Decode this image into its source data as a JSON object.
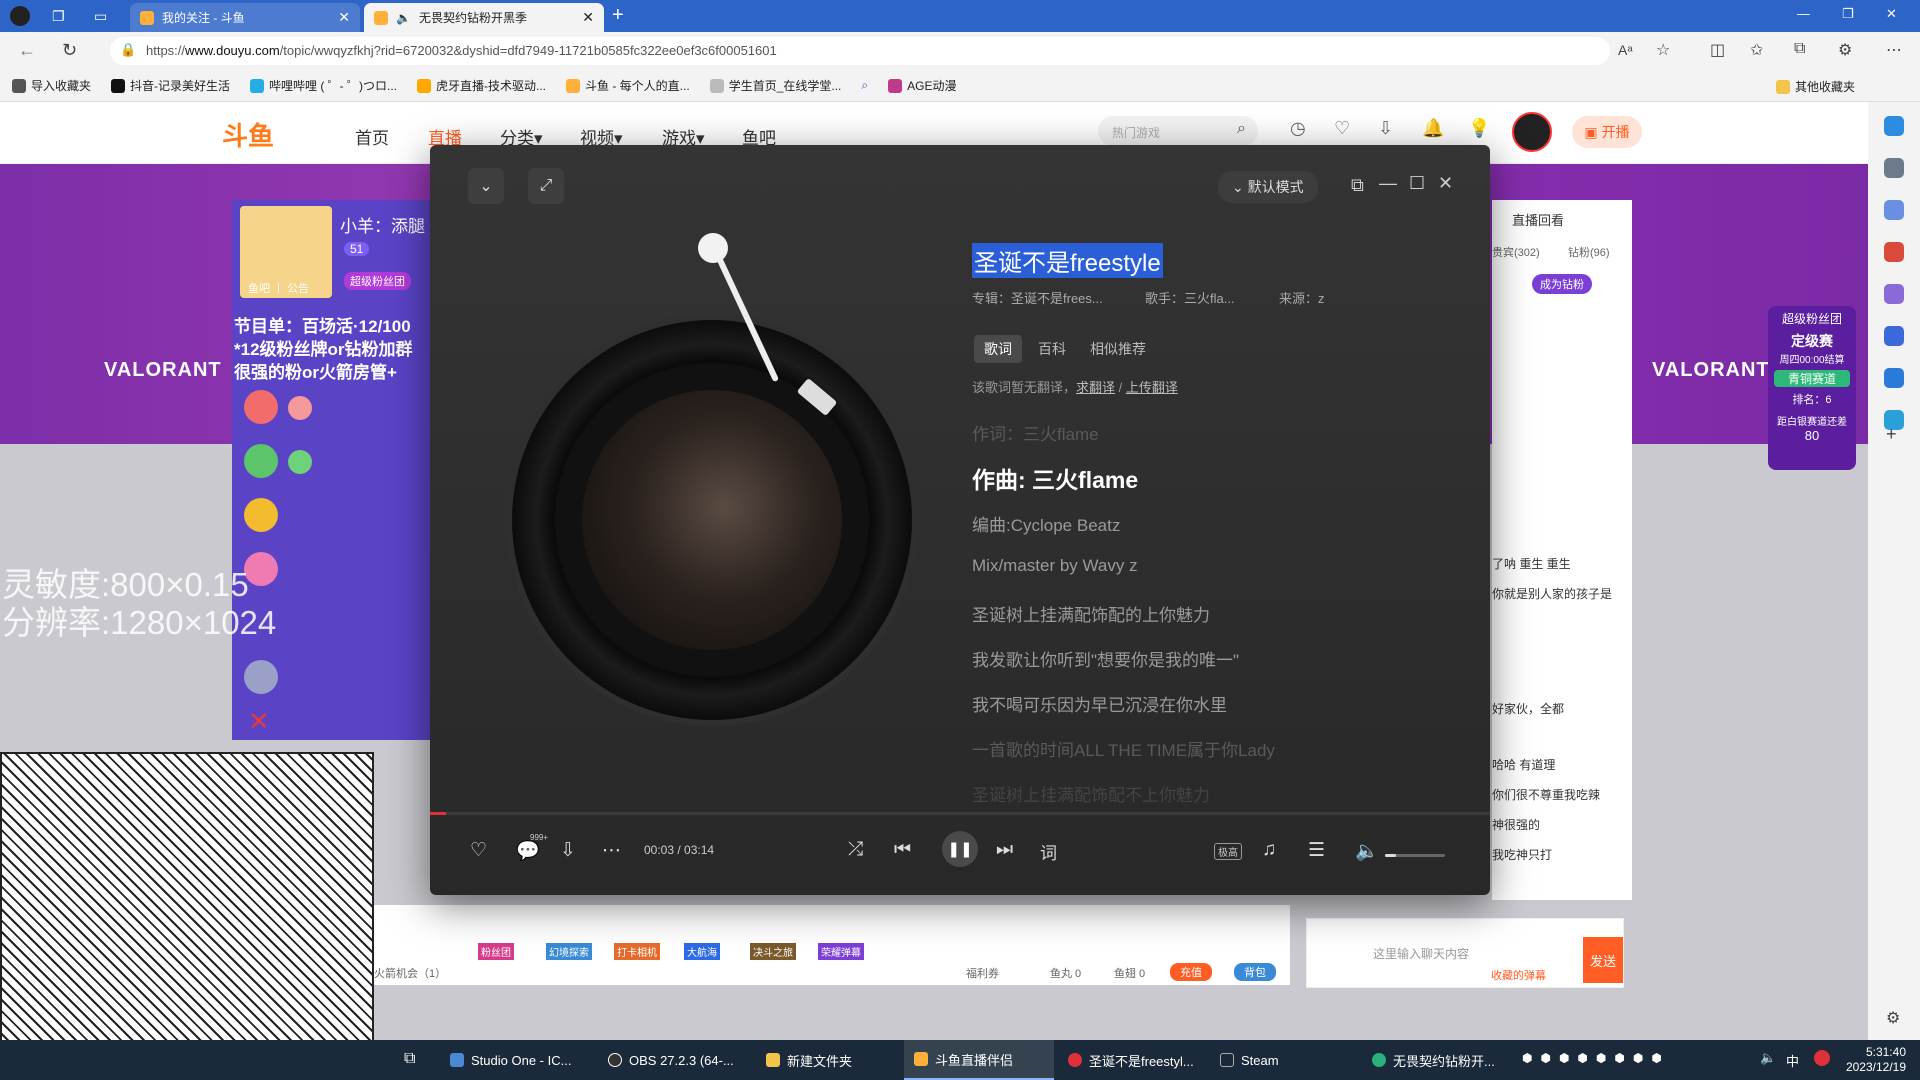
{
  "browser": {
    "tabs": [
      {
        "label": "我的关注 - 斗鱼",
        "active": false
      },
      {
        "label": "无畏契约钻粉开黑季",
        "active": true
      }
    ],
    "url_prefix": "https://",
    "url_domain": "www.douyu.com",
    "url_path": "/topic/wwqyzfkhj?rid=6720032&dyshid=dfd7949-11721b0585fc322ee0ef3c6f00051601",
    "bookmarks": [
      "导入收藏夹",
      "抖音-记录美好生活",
      "哔哩哔哩 ( ゜- ゜)つロ...",
      "虎牙直播-技术驱动...",
      "斗鱼 - 每个人的直...",
      "学生首页_在线学堂...",
      "AGE动漫"
    ],
    "other_bookmarks": "其他收藏夹"
  },
  "site": {
    "logo": "斗鱼",
    "nav": [
      "首页",
      "直播",
      "分类▾",
      "视频▾",
      "游戏▾",
      "鱼吧"
    ],
    "search_placeholder": "热门游戏",
    "live_button": "开播",
    "banner_brand": "VALORANT"
  },
  "stream": {
    "streamer_name": "小羊：添腿",
    "badge_level": "51",
    "fan_club": "超级粉丝团",
    "tags": "鱼吧 丨 公告",
    "schedule_1": "节目单：百场活·12/100",
    "schedule_2": "*12级粉丝牌or钻粉加群",
    "schedule_3": "很强的粉or火箭房管+",
    "overlay_1": "灵敏度:800×0.15",
    "overlay_2": "分辨率:1280×1024"
  },
  "player": {
    "mode": "默认模式",
    "song_title": "圣诞不是freestyle",
    "album": "专辑：圣诞不是frees...",
    "singer": "歌手：三火fla...",
    "source": "来源：z",
    "tabs": [
      "歌词",
      "百科",
      "相似推荐"
    ],
    "translation_note": "该歌词暂无翻译，",
    "translation_req": "求翻译",
    "translation_sep": " / ",
    "translation_upload": "上传翻译",
    "lyrics": [
      {
        "text": "作词：三火flame",
        "state": "dim"
      },
      {
        "text": "作曲: 三火flame",
        "state": "cur"
      },
      {
        "text": "编曲:Cyclope Beatz",
        "state": "normal"
      },
      {
        "text": "Mix/master by Wavy z",
        "state": "normal"
      },
      {
        "text": "圣诞树上挂满配饰配的上你魅力",
        "state": "normal"
      },
      {
        "text": "我发歌让你听到\"想要你是我的唯一\"",
        "state": "normal"
      },
      {
        "text": "我不喝可乐因为早已沉浸在你水里",
        "state": "normal"
      },
      {
        "text": "一首歌的时间ALL THE TIME属于你Lady",
        "state": "dim"
      },
      {
        "text": "圣诞树上挂满配饰配不上你魅力",
        "state": "dim"
      }
    ],
    "current_time": "00:03",
    "total_time": "03:14",
    "progress_fraction": 0.015,
    "volume_fraction": 0.18,
    "comment_count": "999+",
    "quality": "极高",
    "lyric_button": "词"
  },
  "chat": {
    "tabs": [
      "贵宾(302)",
      "钻粉(96)"
    ],
    "replay": "直播回看",
    "become_fan": "成为钻粉",
    "fan_group": "超级粉丝团",
    "rank_title": "定级赛",
    "rank_sub": "周四00:00结算",
    "lane": "青铜赛道",
    "rank": "排名：6",
    "gap": "距白银赛道还差",
    "gap_value": "80",
    "messages": [
      "了呐 重生 重生",
      "你就是别人家的孩子是",
      "好家伙，全都",
      "哈哈 有道理",
      "你们很不尊重我吃辣",
      "神很强的",
      "我吃神只打"
    ],
    "input_placeholder": "这里输入聊天内容",
    "send": "发送",
    "collapse": "收藏的弹幕",
    "fish_ball": "鱼丸 0",
    "fish_wing": "鱼翅 0",
    "recharge": "充值",
    "backpack": "背包",
    "welfare": "福利券",
    "fire_chance": "火箭机会（1）"
  },
  "gifts": [
    "粉丝团",
    "幻境探索",
    "打卡相机",
    "大航海",
    "决斗之旅",
    "荣耀弹幕"
  ],
  "taskbar": {
    "items": [
      "Studio One - IC...",
      "OBS 27.2.3 (64-...",
      "新建文件夹",
      "斗鱼直播伴侣",
      "圣诞不是freestyl...",
      "Steam",
      "无畏契约钻粉开..."
    ],
    "active_index": 3,
    "time": "5:31:40",
    "date": "2023/12/19",
    "ime": "中"
  },
  "colors": {
    "brand": "#ff5d23",
    "tabbar": "#2d64c8",
    "highlight": "#2b5fd8",
    "progress": "#e0303a"
  }
}
